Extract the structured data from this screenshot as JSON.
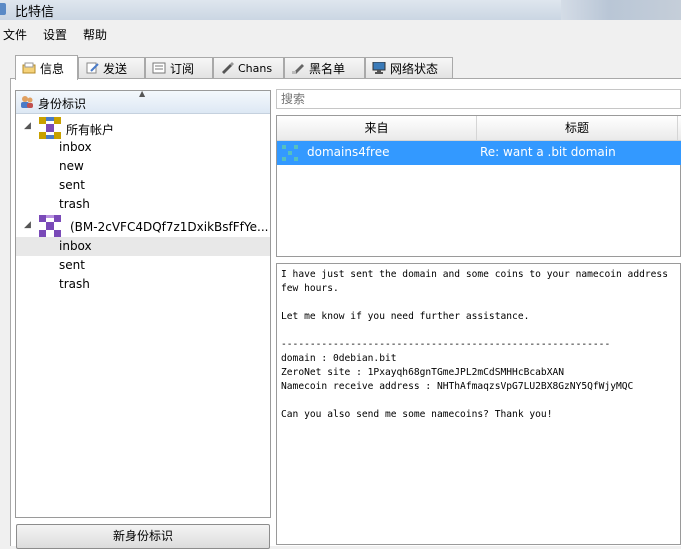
{
  "window": {
    "title": "比特信"
  },
  "menu": [
    "文件",
    "设置",
    "帮助"
  ],
  "tabs": [
    {
      "label": "信息",
      "icon": "inbox-icon",
      "active": true
    },
    {
      "label": "发送",
      "icon": "send-icon"
    },
    {
      "label": "订阅",
      "icon": "subscriptions-icon"
    },
    {
      "label": "Chans",
      "icon": "chans-icon"
    },
    {
      "label": "黑名单",
      "icon": "blacklist-icon"
    },
    {
      "label": "网络状态",
      "icon": "network-status-icon"
    }
  ],
  "tree": {
    "header": "身份标识",
    "all_accounts": "所有帐户",
    "all_folders": [
      "inbox",
      "new",
      "sent",
      "trash"
    ],
    "identity": "(BM-2cVFC4DQf7z1DxikBsfFfYe...",
    "identity_folders": [
      "inbox",
      "sent",
      "trash"
    ]
  },
  "new_identity_button": "新身份标识",
  "search": {
    "placeholder": "搜索"
  },
  "message_list": {
    "columns": [
      "来自",
      "标题"
    ],
    "rows": [
      {
        "from": "domains4free",
        "subject": "Re: want a .bit domain",
        "selected": true
      }
    ]
  },
  "message_body": "I have just sent the domain and some coins to your namecoin address\nfew hours.\n\nLet me know if you need further assistance.\n\n---------------------------------------------------------\ndomain : 0debian.bit\nZeroNet site : 1Pxayqh68gnTGmeJPL2mCdSMHHcBcabXAN\nNamecoin receive address : NHThAfmaqzsVpG7LU2BX8GzNY5QfWjyMQC\n\nCan you also send me some namecoins? Thank you!",
  "colors": {
    "selection": "#3399ff",
    "window_bg": "#f0f0f0"
  }
}
